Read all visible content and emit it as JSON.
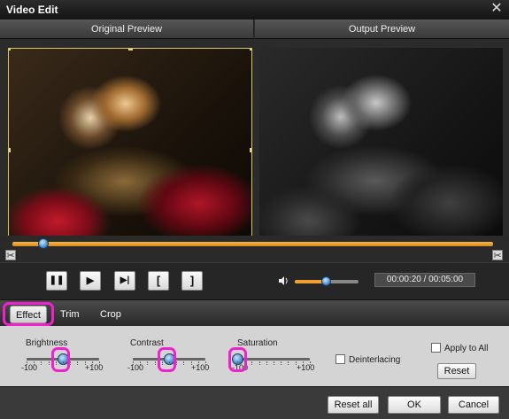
{
  "window": {
    "title": "Video Edit",
    "close_glyph": "✕"
  },
  "preview": {
    "original_label": "Original Preview",
    "output_label": "Output Preview",
    "original_image": "pug-kitten-original",
    "output_image": "pug-kitten-grayscale"
  },
  "timeline": {
    "scissor_glyph": "✂",
    "playhead_fraction": 0.065
  },
  "playback": {
    "pause_glyph": "❚❚",
    "play_glyph": "▶",
    "step_glyph": "▶|",
    "mark_in_glyph": "[",
    "mark_out_glyph": "]",
    "volume_fraction": 0.5,
    "time_display": "00:00:20 / 00:05:00"
  },
  "tabs": [
    {
      "label": "Effect"
    },
    {
      "label": "Trim"
    },
    {
      "label": "Crop"
    }
  ],
  "effect": {
    "brightness": {
      "label": "Brightness",
      "min": "-100",
      "max": "+100",
      "value": 0
    },
    "contrast": {
      "label": "Contrast",
      "min": "-100",
      "max": "+100",
      "value": 0
    },
    "saturation": {
      "label": "Saturation",
      "min": "-100",
      "max": "+100",
      "value": -100
    },
    "deinterlacing_label": "Deinterlacing",
    "apply_to_all_label": "Apply to All",
    "reset_label": "Reset"
  },
  "footer": {
    "reset_all_label": "Reset all",
    "ok_label": "OK",
    "cancel_label": "Cancel"
  },
  "colors": {
    "highlight": "#ee22cc",
    "accent": "#f0a030",
    "thumb": "#4a90d0"
  }
}
